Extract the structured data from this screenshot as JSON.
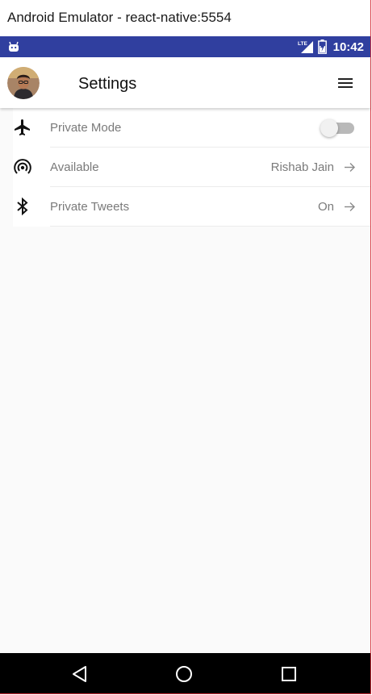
{
  "window": {
    "title": "Android Emulator - react-native:5554"
  },
  "status_bar": {
    "time": "10:42",
    "network_label": "LTE",
    "background": "#303f9f"
  },
  "app_bar": {
    "title": "Settings"
  },
  "settings": {
    "items": [
      {
        "icon": "airplane-icon",
        "label": "Private Mode",
        "control": "toggle",
        "toggle_on": false
      },
      {
        "icon": "hotspot-icon",
        "label": "Available",
        "value": "Rishab Jain",
        "control": "arrow"
      },
      {
        "icon": "bluetooth-icon",
        "label": "Private Tweets",
        "value": "On",
        "control": "arrow"
      }
    ]
  },
  "nav_bar": {
    "buttons": [
      "back-icon",
      "home-icon",
      "recents-icon"
    ]
  }
}
